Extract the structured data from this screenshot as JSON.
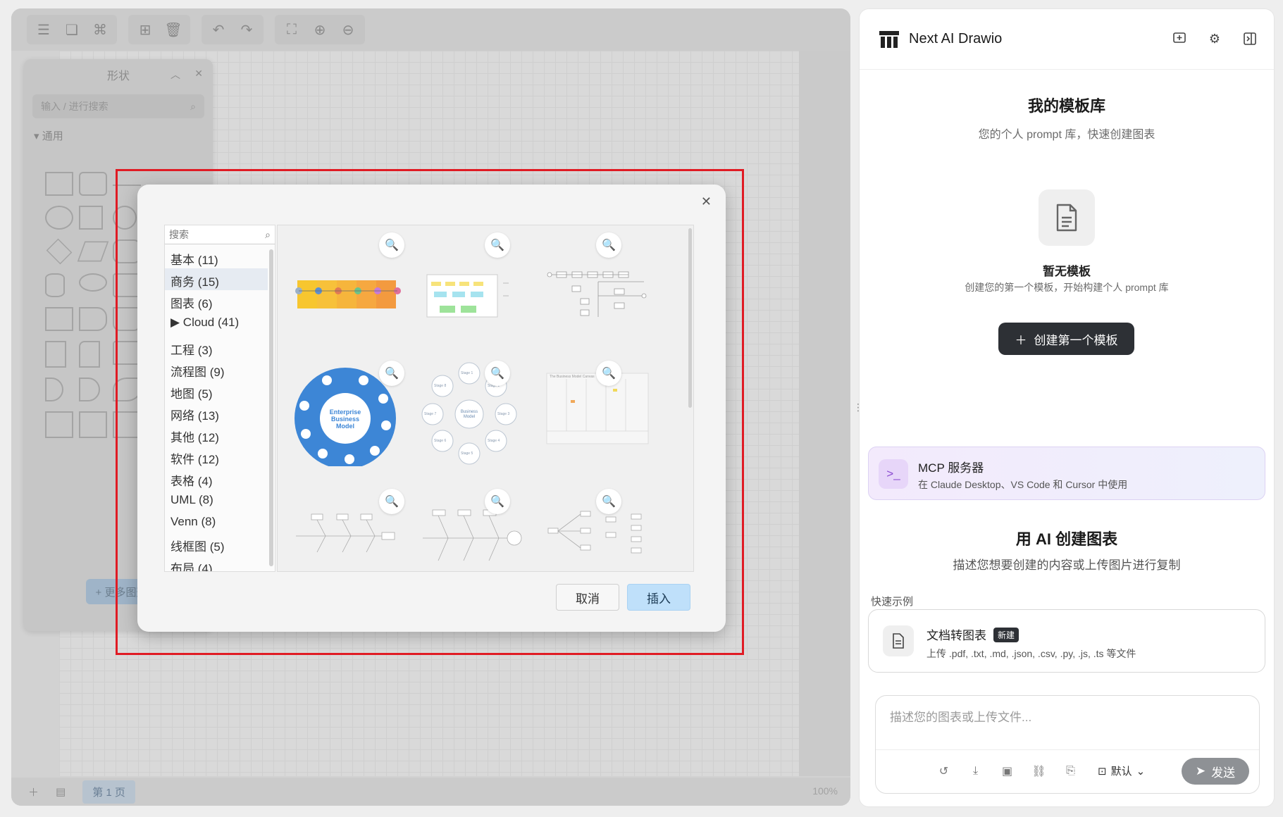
{
  "editor": {
    "shapes_panel": {
      "title": "形状",
      "search_placeholder": "输入 / 进行搜索",
      "section": "通用",
      "more_shapes": "+ 更多图形"
    },
    "bottom_bar": {
      "page_tab": "第 1 页",
      "zoom": "100%"
    }
  },
  "dialog": {
    "search_placeholder": "搜索",
    "categories": [
      "基本 (11)",
      "商务 (15)",
      "图表 (6)",
      "▶  Cloud (41)",
      "工程 (3)",
      "流程图 (9)",
      "地图 (5)",
      "网络 (13)",
      "其他 (12)",
      "软件 (12)",
      "表格 (4)",
      "UML (8)",
      "Venn (8)",
      "线框图 (5)",
      "布局 (4)"
    ],
    "active_category": "商务 (15)",
    "template_previews": {
      "enterprise_model_title": "Enterprise Business Model",
      "business_model_center": "Business Model",
      "stages": [
        "Stage 1",
        "Stage 2",
        "Stage 3",
        "Stage 4",
        "Stage 5",
        "Stage 6",
        "Stage 7",
        "Stage 8"
      ],
      "canvas_title": "The Business Model Canvas"
    },
    "cancel_label": "取消",
    "insert_label": "插入"
  },
  "chat": {
    "app_title": "Next AI Drawio",
    "template_library": {
      "title": "我的模板库",
      "subtitle": "您的个人 prompt 库，快速创建图表",
      "empty_title": "暂无模板",
      "empty_desc": "创建您的第一个模板，开始构建个人 prompt 库",
      "create_button": "创建第一个模板"
    },
    "mcp": {
      "title": "MCP 服务器",
      "desc": "在 Claude Desktop、VS Code 和 Cursor 中使用"
    },
    "ai_section": {
      "title": "用 AI 创建图表",
      "subtitle": "描述您想要创建的内容或上传图片进行复制"
    },
    "quick_examples_label": "快速示例",
    "doc_example": {
      "title": "文档转图表",
      "badge": "新建",
      "desc": "上传 .pdf, .txt, .md, .json, .csv, .py, .js, .ts 等文件"
    },
    "input": {
      "placeholder": "描述您的图表或上传文件...",
      "model": "默认",
      "send": "发送"
    }
  },
  "colors": {
    "highlight": "#e01b24",
    "insert_button": "#bfe0fa",
    "dark_button": "#2d3035",
    "mcp_accent": "#8b4ad1",
    "enterprise_blue": "#3d86d6"
  }
}
